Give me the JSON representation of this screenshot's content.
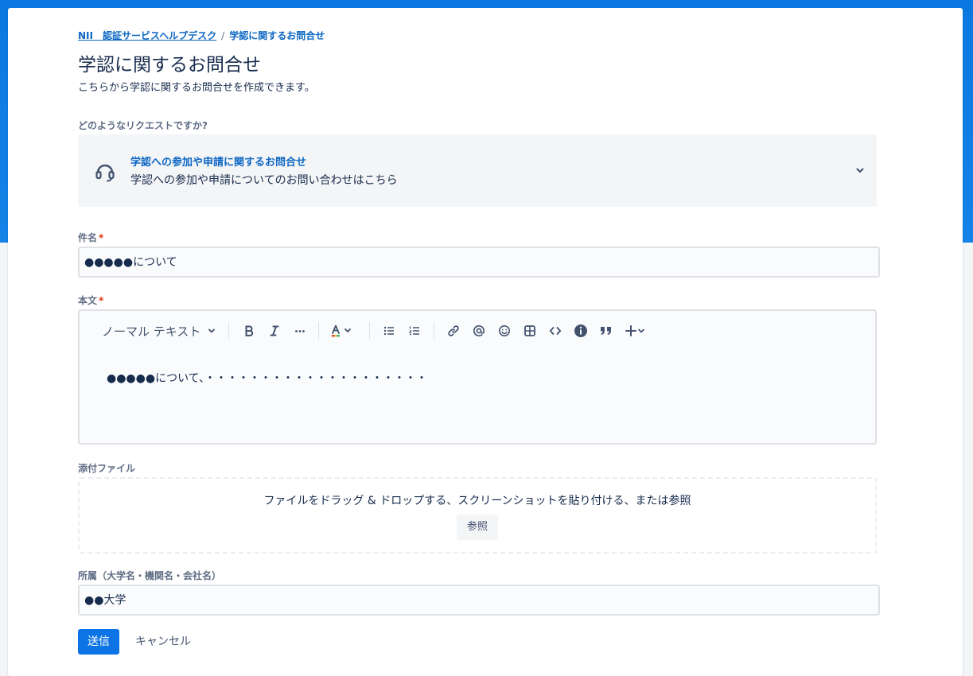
{
  "breadcrumb": {
    "items": [
      "NII　認証サービスヘルプデスク",
      "学認に関するお問合せ"
    ],
    "separator": "/"
  },
  "page": {
    "title": "学認に関するお問合せ",
    "description": "こちらから学認に関するお問合せを作成できます。"
  },
  "request_type": {
    "label": "どのようなリクエストですか?",
    "selected_title": "学認への参加や申請に関するお問合せ",
    "selected_description": "学認への参加や申請についてのお問い合わせはこちら",
    "icon": "headset-icon"
  },
  "subject": {
    "label": "件名",
    "required_mark": "*",
    "value": "●●●●●について"
  },
  "body": {
    "label": "本文",
    "required_mark": "*",
    "text_style": "ノーマル テキスト",
    "value": "●●●●●について、・・・・・・・・・・・・・・・・・・・・",
    "toolbar_icons": [
      "bold-icon",
      "italic-icon",
      "more-formatting-icon",
      "text-color-icon",
      "bullet-list-icon",
      "numbered-list-icon",
      "link-icon",
      "mention-icon",
      "emoji-icon",
      "table-icon",
      "code-icon",
      "info-panel-icon",
      "quote-icon",
      "insert-plus-icon"
    ]
  },
  "attachment": {
    "label": "添付ファイル",
    "dropzone_text": "ファイルをドラッグ & ドロップする、スクリーンショットを貼り付ける、または参照",
    "browse_label": "参照"
  },
  "affiliation": {
    "label": "所属（大学名・機関名・会社名）",
    "value": "●●大学"
  },
  "actions": {
    "submit_label": "送信",
    "cancel_label": "キャンセル"
  },
  "colors": {
    "brand_blue": "#0c74e4",
    "link_blue": "#0b66c3",
    "required_red": "#de350b"
  }
}
